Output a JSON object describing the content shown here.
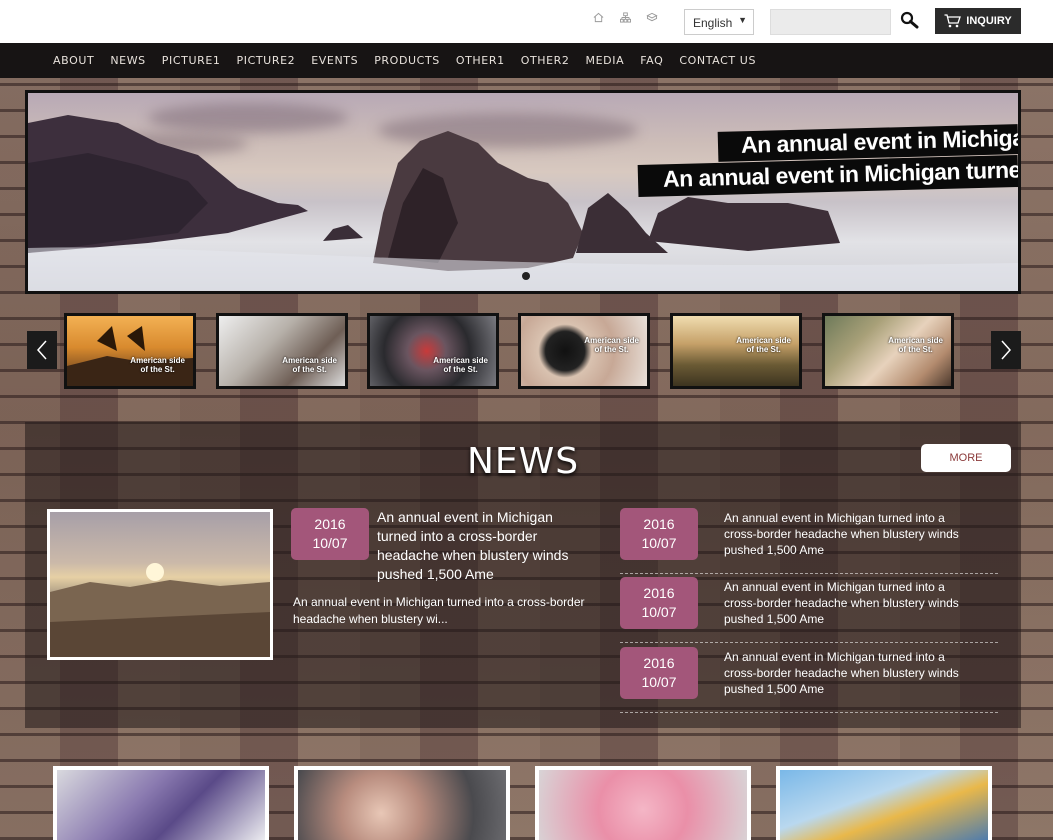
{
  "header": {
    "icons": [
      "home-icon",
      "sitemap-icon",
      "bookmark-icon"
    ],
    "language": "English",
    "search_placeholder": "",
    "inquiry_label": "INQUIRY"
  },
  "nav": {
    "items": [
      {
        "label": "ABOUT"
      },
      {
        "label": "NEWS"
      },
      {
        "label": "PICTURE1"
      },
      {
        "label": "PICTURE2"
      },
      {
        "label": "EVENTS"
      },
      {
        "label": "PRODUCTS"
      },
      {
        "label": "OTHER1"
      },
      {
        "label": "OTHER2"
      },
      {
        "label": "MEDIA"
      },
      {
        "label": "FAQ"
      },
      {
        "label": "CONTACT US"
      }
    ]
  },
  "hero": {
    "line1": "An annual event in Michigan",
    "line2": "An annual event in Michigan turned"
  },
  "thumbs": {
    "caption_line1": "American side",
    "caption_line2": "of the St."
  },
  "news": {
    "title": "NEWS",
    "more_label": "MORE",
    "featured": {
      "year": "2016",
      "day": "10/07",
      "title": "An annual event in Michigan turned into a cross-border headache when blustery winds pushed 1,500 Ame",
      "summary": "An annual event in Michigan turned into a cross-border headache when blustery wi..."
    },
    "items": [
      {
        "year": "2016",
        "day": "10/07",
        "text": "An annual event in Michigan turned into a cross-border headache when blustery winds pushed 1,500 Ame"
      },
      {
        "year": "2016",
        "day": "10/07",
        "text": "An annual event in Michigan turned into a cross-border headache when blustery winds pushed 1,500 Ame"
      },
      {
        "year": "2016",
        "day": "10/07",
        "text": "An annual event in Michigan turned into a cross-border headache when blustery winds pushed 1,500 Ame"
      }
    ]
  },
  "colors": {
    "accent": "#a3567a",
    "nav_bg": "#171414",
    "inquiry_bg": "#2b2b2b"
  }
}
